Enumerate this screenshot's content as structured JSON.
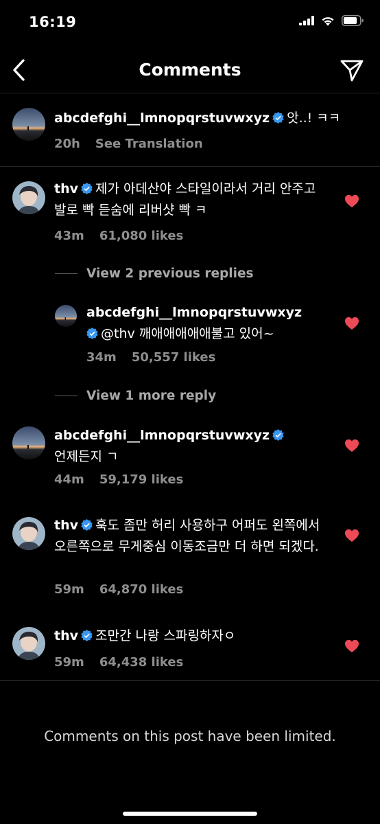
{
  "status_bar": {
    "time": "16:19"
  },
  "nav": {
    "title": "Comments"
  },
  "caption": {
    "username": "abcdefghi__lmnopqrstuvwxyz",
    "text": "앗..! ㅋㅋ",
    "time": "20h",
    "translate_label": "See Translation"
  },
  "comments": [
    {
      "username": "thv",
      "text": "제가 아데산야 스타일이라서 거리 안주고 발로 빡 듣숨에 리버샷 빡 ㅋ",
      "time": "43m",
      "likes": "61,080 likes"
    },
    {
      "username": "abcdefghi__lmnopqrstuvwxyz",
      "text": "언제든지 ㄱ",
      "time": "44m",
      "likes": "59,179 likes"
    },
    {
      "username": "thv",
      "text": "훅도 좀만 허리 사용하구 어퍼도 왼쪽에서 오른쪽으로 무게중심 이동조금만 더 하면 되겠다.",
      "time": "59m",
      "likes": "64,870 likes"
    },
    {
      "username": "thv",
      "text": "조만간 나랑 스파링하자ㅇ",
      "time": "59m",
      "likes": "64,438 likes"
    }
  ],
  "replies_block": {
    "view_previous": "View 2 previous replies",
    "reply": {
      "username": "abcdefghi__lmnopqrstuvwxyz",
      "text": "@thv 깨애애애애애불고 있어~",
      "time": "34m",
      "likes": "50,557 likes"
    },
    "view_more": "View 1 more reply"
  },
  "footer": {
    "limited_text": "Comments on this post have been limited."
  },
  "colors": {
    "background": "#000000",
    "meta": "#8e8e8e",
    "heart": "#ed4956",
    "verified": "#3897f0"
  }
}
